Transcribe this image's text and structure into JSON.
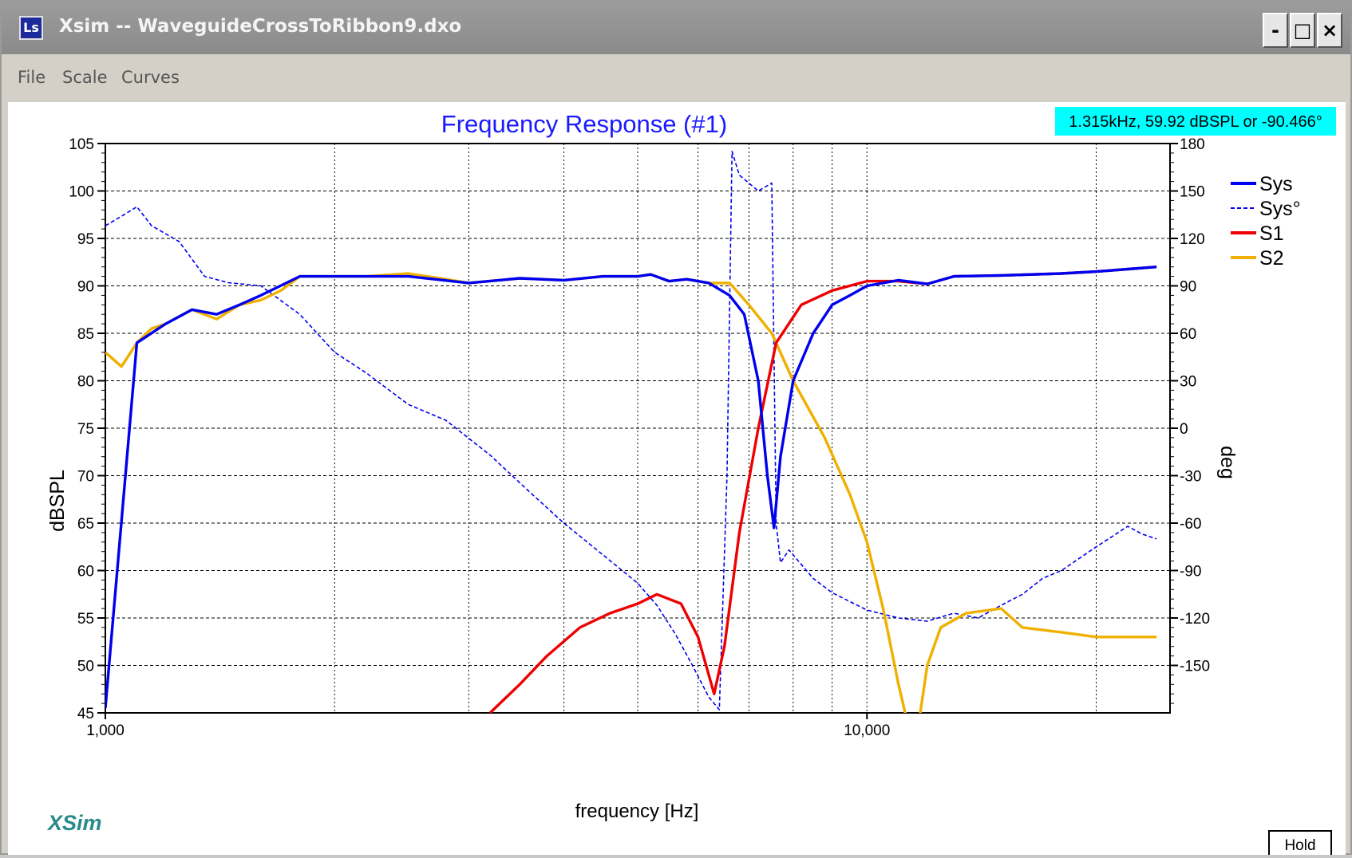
{
  "window": {
    "title": "Xsim -- WaveguideCrossToRibbon9.dxo",
    "icon": "app-icon",
    "min": "-",
    "max": "□",
    "close": "×"
  },
  "menu": {
    "items": [
      "File",
      "Scale",
      "Curves"
    ]
  },
  "cursor_readout": "1.315kHz, 59.92 dBSPL or -90.466°",
  "watermark": "XSim",
  "hold_label": "Hold",
  "colors": {
    "Sys": "#0000ee",
    "S1": "#ee0000",
    "S2": "#f0b000",
    "readout_bg": "#00ffff",
    "title": "#1a1aff"
  },
  "chart_data": {
    "type": "line",
    "title": "Frequency Response (#1)",
    "xlabel": "frequency [Hz]",
    "ylabel": "dBSPL",
    "y2label": "deg",
    "xscale": "log",
    "xlim": [
      1000,
      25000
    ],
    "ylim": [
      45,
      105
    ],
    "y2lim": [
      -180,
      180
    ],
    "xticks": [
      {
        "value": 1000,
        "label": "1,000"
      },
      {
        "value": 10000,
        "label": "10,000"
      }
    ],
    "yticks": [
      45,
      50,
      55,
      60,
      65,
      70,
      75,
      80,
      85,
      90,
      95,
      100,
      105
    ],
    "y2ticks": [
      -150,
      -120,
      -90,
      -60,
      -30,
      0,
      30,
      60,
      90,
      120,
      150,
      180
    ],
    "grid": true,
    "legend_position": "top-right",
    "series": [
      {
        "name": "Sys",
        "axis": "left",
        "style": "solid",
        "points": [
          [
            1000,
            45.5
          ],
          [
            1100,
            84
          ],
          [
            1200,
            86
          ],
          [
            1300,
            87.5
          ],
          [
            1400,
            87
          ],
          [
            1500,
            88
          ],
          [
            1600,
            89
          ],
          [
            1800,
            91
          ],
          [
            2000,
            91
          ],
          [
            2200,
            91
          ],
          [
            2500,
            91
          ],
          [
            3000,
            90.3
          ],
          [
            3500,
            90.8
          ],
          [
            4000,
            90.6
          ],
          [
            4500,
            91
          ],
          [
            5000,
            91
          ],
          [
            5200,
            91.2
          ],
          [
            5500,
            90.5
          ],
          [
            5800,
            90.7
          ],
          [
            6200,
            90.3
          ],
          [
            6600,
            89
          ],
          [
            6900,
            87
          ],
          [
            7200,
            80
          ],
          [
            7400,
            70
          ],
          [
            7550,
            64.5
          ],
          [
            7700,
            72
          ],
          [
            8000,
            80
          ],
          [
            8500,
            85
          ],
          [
            9000,
            88
          ],
          [
            9500,
            89
          ],
          [
            10000,
            90
          ],
          [
            11000,
            90.6
          ],
          [
            12000,
            90.2
          ],
          [
            13000,
            91
          ],
          [
            15000,
            91.1
          ],
          [
            18000,
            91.3
          ],
          [
            20000,
            91.5
          ],
          [
            24000,
            92
          ]
        ]
      },
      {
        "name": "Sys°",
        "axis": "right",
        "style": "dashed",
        "points": [
          [
            1000,
            128
          ],
          [
            1050,
            134
          ],
          [
            1100,
            140
          ],
          [
            1150,
            128
          ],
          [
            1250,
            118
          ],
          [
            1350,
            96
          ],
          [
            1450,
            92
          ],
          [
            1600,
            90
          ],
          [
            1800,
            72
          ],
          [
            2000,
            48
          ],
          [
            2200,
            35
          ],
          [
            2500,
            15
          ],
          [
            2800,
            5
          ],
          [
            3200,
            -17
          ],
          [
            3600,
            -40
          ],
          [
            4000,
            -60
          ],
          [
            4500,
            -80
          ],
          [
            5000,
            -98
          ],
          [
            5300,
            -112
          ],
          [
            5600,
            -130
          ],
          [
            5900,
            -150
          ],
          [
            6200,
            -170
          ],
          [
            6400,
            -178
          ],
          [
            6550,
            -30
          ],
          [
            6650,
            175
          ],
          [
            6800,
            160
          ],
          [
            7200,
            150
          ],
          [
            7500,
            155
          ],
          [
            7600,
            -60
          ],
          [
            7700,
            -85
          ],
          [
            7900,
            -77
          ],
          [
            8500,
            -95
          ],
          [
            9000,
            -104
          ],
          [
            10000,
            -115
          ],
          [
            11000,
            -120
          ],
          [
            12000,
            -122
          ],
          [
            13000,
            -117
          ],
          [
            14000,
            -120
          ],
          [
            15000,
            -112
          ],
          [
            16000,
            -105
          ],
          [
            17000,
            -95
          ],
          [
            18000,
            -90
          ],
          [
            20000,
            -75
          ],
          [
            22000,
            -62
          ],
          [
            23000,
            -67
          ],
          [
            24000,
            -70
          ]
        ]
      },
      {
        "name": "S1",
        "axis": "left",
        "style": "solid",
        "points": [
          [
            3200,
            45
          ],
          [
            3500,
            48
          ],
          [
            3800,
            51
          ],
          [
            4200,
            54
          ],
          [
            4600,
            55.5
          ],
          [
            5000,
            56.5
          ],
          [
            5300,
            57.5
          ],
          [
            5700,
            56.5
          ],
          [
            6000,
            53
          ],
          [
            6300,
            47
          ],
          [
            6500,
            52
          ],
          [
            6800,
            64
          ],
          [
            7200,
            75
          ],
          [
            7600,
            84
          ],
          [
            8200,
            88
          ],
          [
            9000,
            89.5
          ],
          [
            10000,
            90.5
          ],
          [
            11000,
            90.5
          ],
          [
            12000,
            90.2
          ],
          [
            13000,
            91
          ],
          [
            15000,
            91.1
          ],
          [
            18000,
            91.3
          ],
          [
            20000,
            91.5
          ],
          [
            24000,
            92
          ]
        ]
      },
      {
        "name": "S2",
        "axis": "left",
        "style": "solid",
        "points": [
          [
            1000,
            83
          ],
          [
            1050,
            81.5
          ],
          [
            1100,
            84
          ],
          [
            1150,
            85.5
          ],
          [
            1200,
            86
          ],
          [
            1300,
            87.5
          ],
          [
            1400,
            86.5
          ],
          [
            1500,
            88
          ],
          [
            1600,
            88.5
          ],
          [
            1700,
            89.5
          ],
          [
            1800,
            91
          ],
          [
            2000,
            91
          ],
          [
            2200,
            91
          ],
          [
            2500,
            91.3
          ],
          [
            2800,
            90.7
          ],
          [
            3000,
            90.3
          ],
          [
            3500,
            90.8
          ],
          [
            4000,
            90.6
          ],
          [
            4500,
            91
          ],
          [
            5000,
            91
          ],
          [
            5200,
            91.2
          ],
          [
            5500,
            90.5
          ],
          [
            5800,
            90.7
          ],
          [
            6200,
            90.3
          ],
          [
            6600,
            90.3
          ],
          [
            7000,
            88
          ],
          [
            7500,
            85
          ],
          [
            8000,
            80
          ],
          [
            8800,
            74
          ],
          [
            9500,
            68
          ],
          [
            10000,
            63
          ],
          [
            10500,
            56
          ],
          [
            11000,
            48
          ],
          [
            11300,
            44
          ],
          [
            11700,
            44
          ],
          [
            12000,
            50
          ],
          [
            12500,
            54
          ],
          [
            13500,
            55.5
          ],
          [
            15000,
            56
          ],
          [
            16000,
            54
          ],
          [
            18000,
            53.5
          ],
          [
            20000,
            53
          ],
          [
            22000,
            53
          ],
          [
            24000,
            53
          ]
        ]
      }
    ]
  }
}
